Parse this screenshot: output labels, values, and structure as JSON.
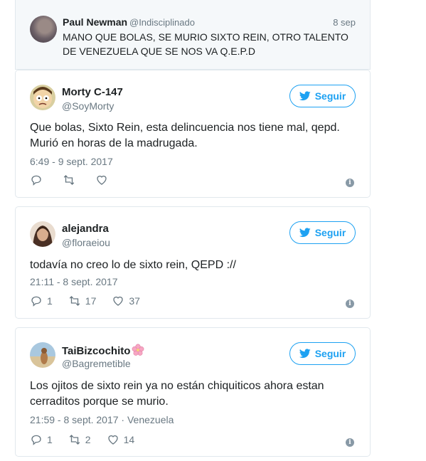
{
  "quoted": {
    "name": "Paul Newman",
    "handle": "@Indisciplinado",
    "date": "8 sep",
    "text": "MANO QUE BOLAS, SE MURIO SIXTO REIN, OTRO TALENTO DE VENEZUELA QUE SE NOS VA Q.E.P.D"
  },
  "tweets": [
    {
      "name": "Morty C-147",
      "handle": "@SoyMorty",
      "follow_label": "Seguir",
      "text": "Que bolas, Sixto Rein, esta delincuencia nos tiene mal, qepd. Murió en horas de la madrugada.",
      "timestamp": "6:49 - 9 sept. 2017",
      "replies": "",
      "retweets": "",
      "likes": ""
    },
    {
      "name": "alejandra",
      "handle": "@floraeiou",
      "follow_label": "Seguir",
      "text": "todavía no creo lo de sixto rein, QEPD ://",
      "timestamp": "21:11 - 8 sept. 2017",
      "replies": "1",
      "retweets": "17",
      "likes": "37"
    },
    {
      "name": "TaiBizcochito",
      "handle": "@Bagremetible",
      "follow_label": "Seguir",
      "text": "Los ojitos de sixto rein ya no están chiquiticos ahora estan cerraditos porque se murio.",
      "timestamp": "21:59 - 8 sept. 2017 · Venezuela",
      "replies": "1",
      "retweets": "2",
      "likes": "14"
    }
  ],
  "colors": {
    "accent": "#1da1f2",
    "muted": "#697882",
    "border": "#e1e8ed"
  }
}
